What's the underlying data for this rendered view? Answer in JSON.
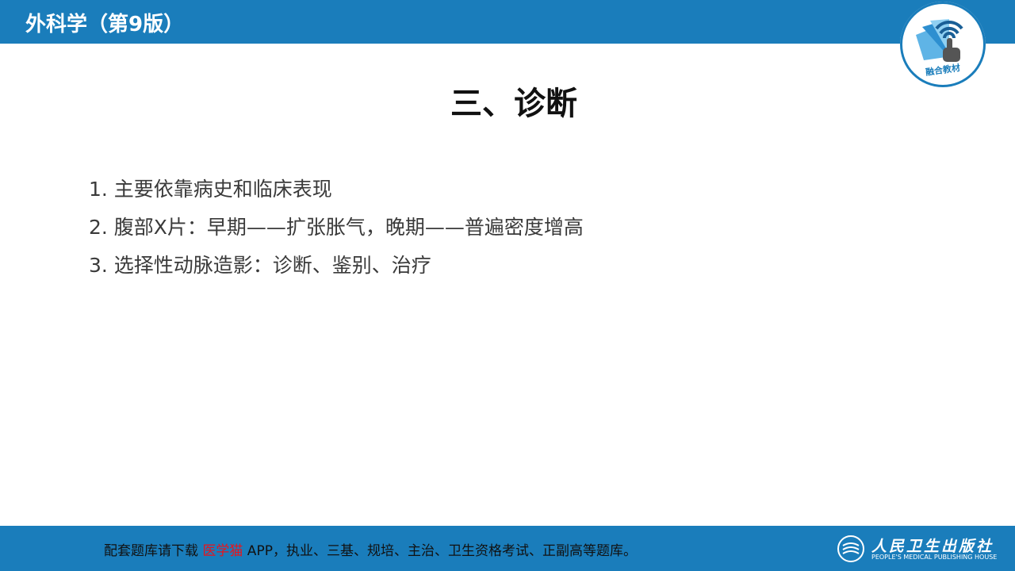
{
  "header": {
    "title": "外科学（第9版）",
    "accent_color": "#1a7dbb"
  },
  "badge": {
    "icon": "wifi-hand-book-icon",
    "label": "融合教材"
  },
  "slide": {
    "title": "三、诊断",
    "items": [
      "1. 主要依靠病史和临床表现",
      "2. 腹部X片：早期——扩张胀气，晚期——普遍密度增高",
      "3. 选择性动脉造影：诊断、鉴别、治疗"
    ]
  },
  "footer": {
    "text_before": "配套题库请下载",
    "highlight": "医学猫",
    "text_after": " APP，执业、三基、规培、主治、卫生资格考试、正副高等题库。",
    "highlight_color": "#e8141c",
    "publisher_name": "人民卫生出版社",
    "publisher_sub": "PEOPLE'S MEDICAL PUBLISHING HOUSE",
    "publisher_icon": "pmph-emblem-icon"
  }
}
